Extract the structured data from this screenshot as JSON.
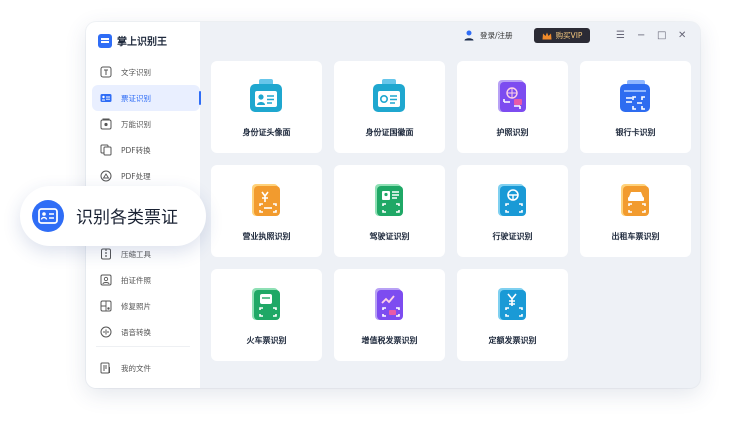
{
  "app": {
    "name": "掌上识别王"
  },
  "header": {
    "login_label": "登录/注册",
    "vip_label": "购买VIP"
  },
  "sidebar": {
    "items": [
      {
        "label": "文字识别",
        "icon": "text-recognize-icon"
      },
      {
        "label": "票证识别",
        "icon": "card-id-icon",
        "active": true
      },
      {
        "label": "万能识别",
        "icon": "camera-icon"
      },
      {
        "label": "PDF转换",
        "icon": "pdf-convert-icon"
      },
      {
        "label": "PDF处理",
        "icon": "pdf-process-icon"
      }
    ],
    "items_lower": [
      {
        "label": "压缩工具",
        "icon": "compress-icon"
      },
      {
        "label": "拍证件照",
        "icon": "id-photo-icon"
      },
      {
        "label": "修复照片",
        "icon": "photo-repair-icon"
      },
      {
        "label": "语音转换",
        "icon": "voice-convert-icon"
      }
    ],
    "my_files": "我的文件"
  },
  "callout": {
    "label": "识别各类票证"
  },
  "cards": [
    {
      "label": "身份证头像面",
      "icon": "id-card-portrait-icon"
    },
    {
      "label": "身份证国徽面",
      "icon": "id-card-emblem-icon"
    },
    {
      "label": "护照识别",
      "icon": "passport-icon"
    },
    {
      "label": "银行卡识别",
      "icon": "bank-card-icon"
    },
    {
      "label": "营业执照识别",
      "icon": "business-license-icon"
    },
    {
      "label": "驾驶证识别",
      "icon": "driver-license-icon"
    },
    {
      "label": "行驶证识别",
      "icon": "vehicle-license-icon"
    },
    {
      "label": "出租车票识别",
      "icon": "taxi-receipt-icon"
    },
    {
      "label": "火车票识别",
      "icon": "train-ticket-icon"
    },
    {
      "label": "增值税发票识别",
      "icon": "vat-invoice-icon"
    },
    {
      "label": "定额发票识别",
      "icon": "quota-invoice-icon"
    }
  ],
  "colors": {
    "accent": "#2f6df6",
    "teal": "#1fa7cf",
    "purple": "#7d4cf0",
    "blue": "#2e6cf0",
    "orange": "#f29b2e",
    "green": "#1fa866"
  }
}
